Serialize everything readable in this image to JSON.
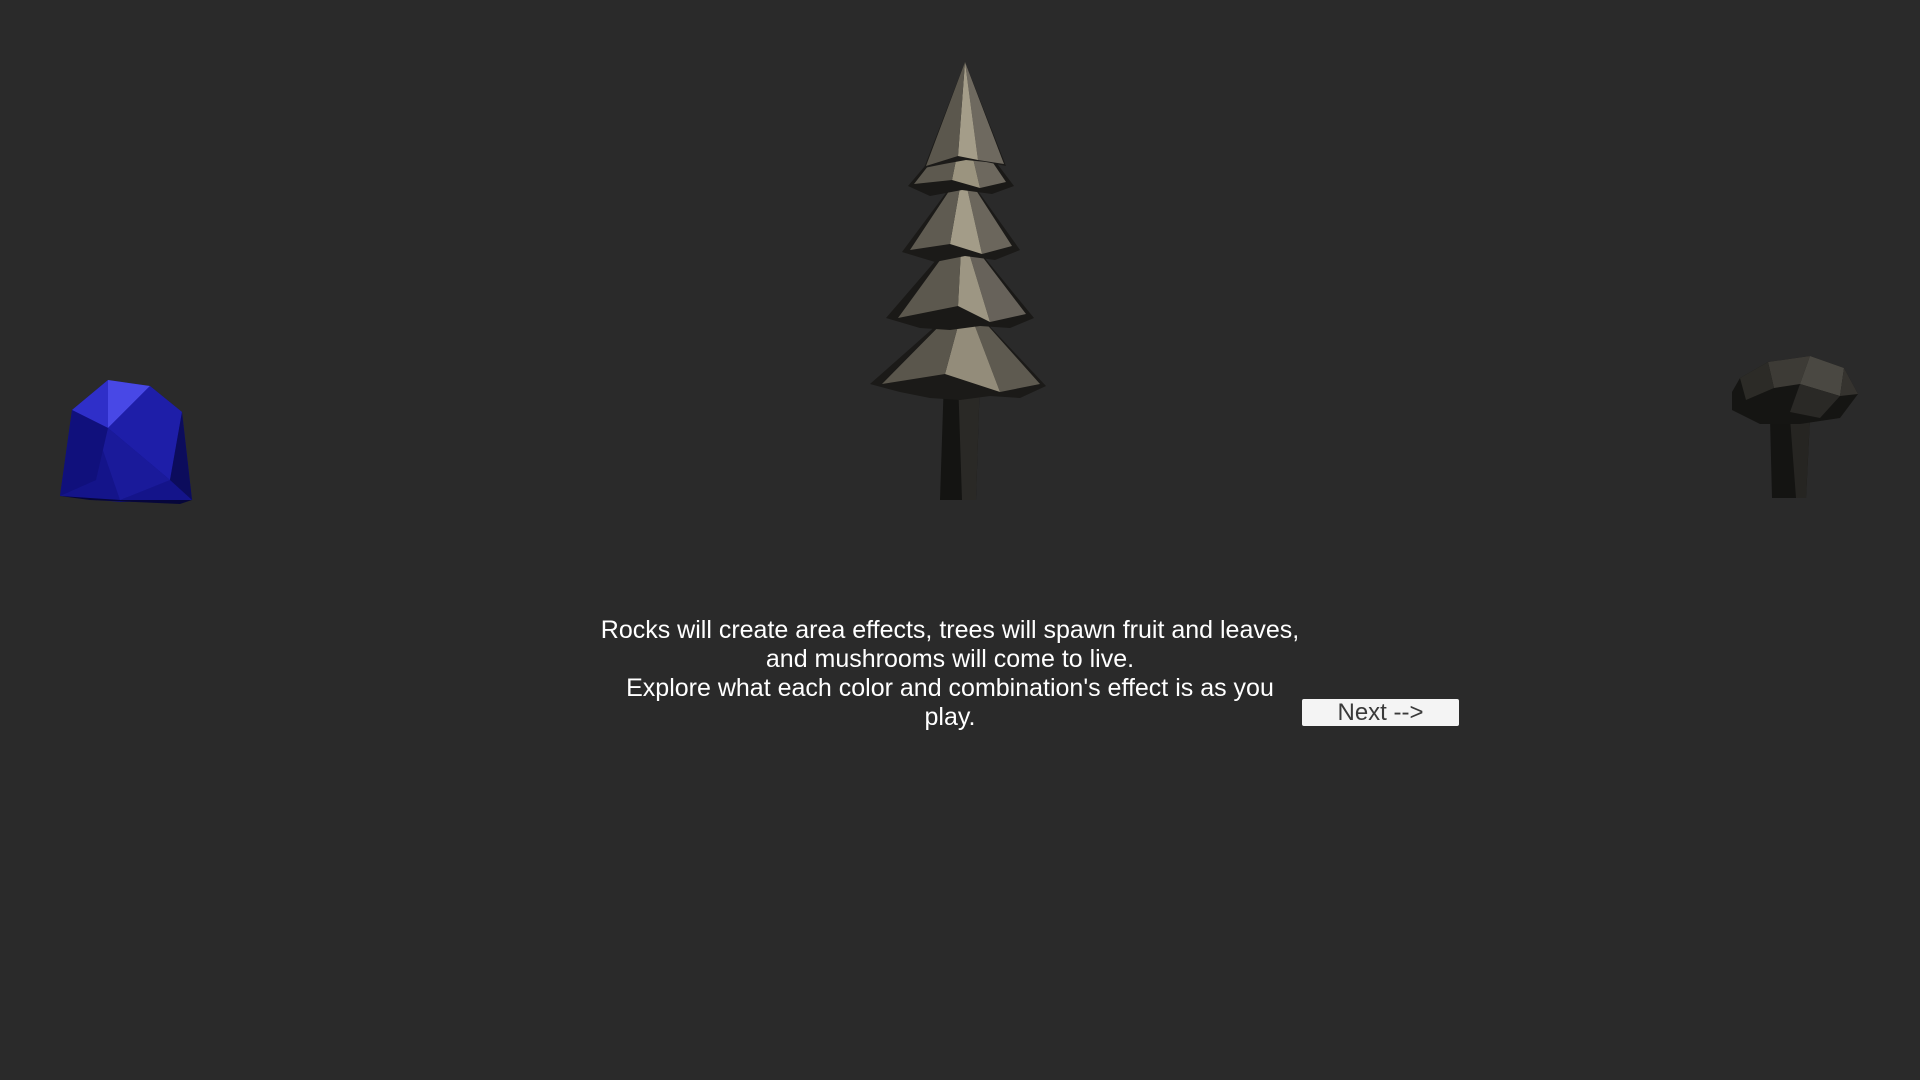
{
  "tutorial": {
    "message": "Rocks will create area effects, trees will spawn fruit and leaves, and mushrooms will come to live.\nExplore what each color and combination's effect is as you play."
  },
  "controls": {
    "next_label": "Next -->"
  },
  "scene": {
    "background_color": "#2a2a2a",
    "props": [
      {
        "name": "rock",
        "color": "#2323b8"
      },
      {
        "name": "pine-tree",
        "color": "#8f8878"
      },
      {
        "name": "mushroom",
        "color": "#3a3834"
      }
    ]
  }
}
